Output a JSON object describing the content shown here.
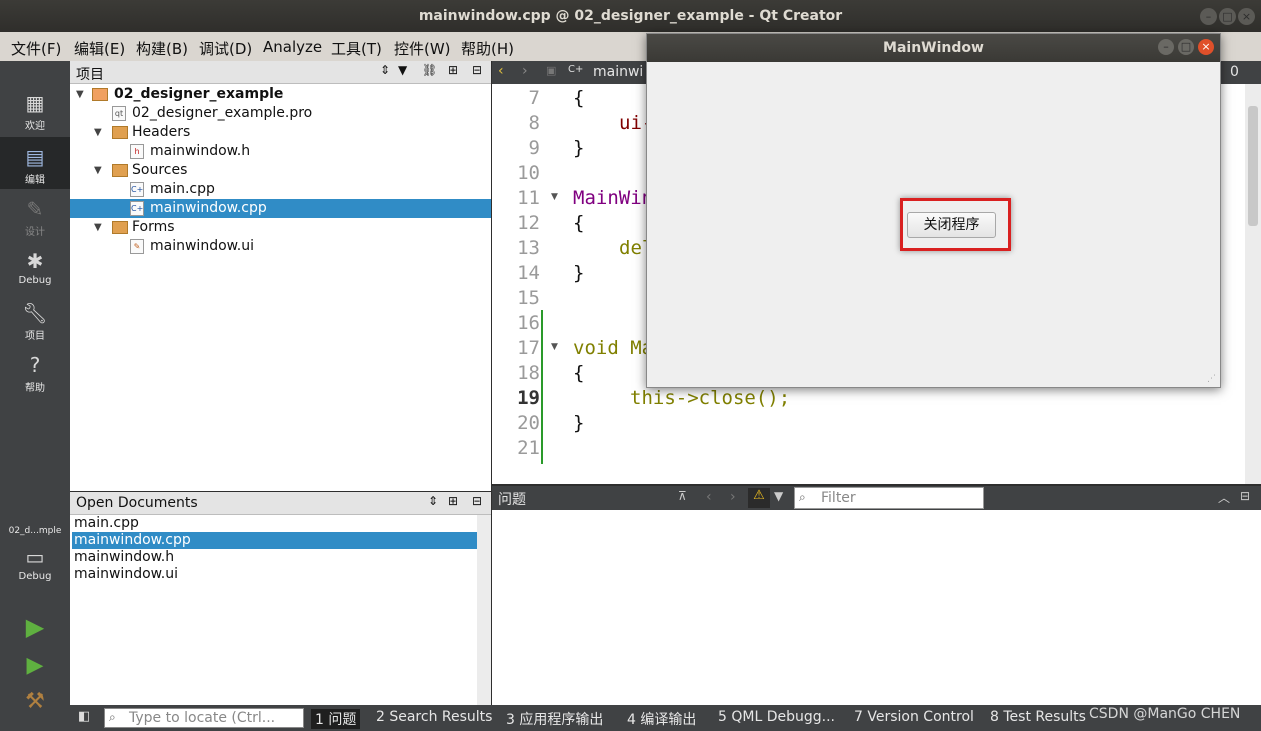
{
  "window": {
    "title": "mainwindow.cpp @ 02_designer_example - Qt Creator"
  },
  "menu": [
    "文件(F)",
    "编辑(E)",
    "构建(B)",
    "调试(D)",
    "Analyze",
    "工具(T)",
    "控件(W)",
    "帮助(H)"
  ],
  "modes": [
    {
      "label": "欢迎",
      "icon": "grid-icon"
    },
    {
      "label": "编辑",
      "icon": "edit-icon"
    },
    {
      "label": "设计",
      "icon": "pencil-icon"
    },
    {
      "label": "Debug",
      "icon": "bug-icon"
    },
    {
      "label": "项目",
      "icon": "wrench-icon"
    },
    {
      "label": "帮助",
      "icon": "help-icon"
    }
  ],
  "kit": {
    "project": "02_d...mple",
    "mode": "Debug"
  },
  "project_panel": {
    "title": "项目",
    "tree": [
      {
        "label": "02_designer_example",
        "type": "project"
      },
      {
        "label": "02_designer_example.pro",
        "type": "pro"
      },
      {
        "label": "Headers",
        "type": "folder"
      },
      {
        "label": "mainwindow.h",
        "type": "header"
      },
      {
        "label": "Sources",
        "type": "folder"
      },
      {
        "label": "main.cpp",
        "type": "cpp"
      },
      {
        "label": "mainwindow.cpp",
        "type": "cpp",
        "selected": true
      },
      {
        "label": "Forms",
        "type": "folder"
      },
      {
        "label": "mainwindow.ui",
        "type": "ui"
      }
    ]
  },
  "editor": {
    "tab_file": "mainwi",
    "line_col_fragment": "0",
    "line_numbers": [
      "7",
      "8",
      "9",
      "10",
      "11",
      "12",
      "13",
      "14",
      "15",
      "16",
      "17",
      "18",
      "19",
      "20",
      "21"
    ],
    "lines": [
      "{",
      "ui-",
      "}",
      "",
      "MainWin",
      "{",
      "del",
      "}",
      "",
      "",
      "void Ma",
      "{",
      "this->close();",
      "}",
      ""
    ]
  },
  "open_docs": {
    "title": "Open Documents",
    "items": [
      "main.cpp",
      "mainwindow.cpp",
      "mainwindow.h",
      "mainwindow.ui"
    ],
    "selected": 1
  },
  "issues": {
    "title": "问题",
    "filter_placeholder": "Filter"
  },
  "statusbar": {
    "locate_placeholder": "Type to locate (Ctrl...",
    "tabs": [
      "1 问题",
      "2 Search Results",
      "3 应用程序输出",
      "4 编译输出",
      "5 QML Debugg...",
      "7 Version Control",
      "8 Test Results"
    ]
  },
  "app_window": {
    "title": "MainWindow",
    "button_label": "关闭程序",
    "highlight_color": "#d92020"
  },
  "watermark": "CSDN @ManGo CHEN",
  "colors": {
    "selection": "#308cc6",
    "keyword": "#808000",
    "type": "#800080"
  }
}
